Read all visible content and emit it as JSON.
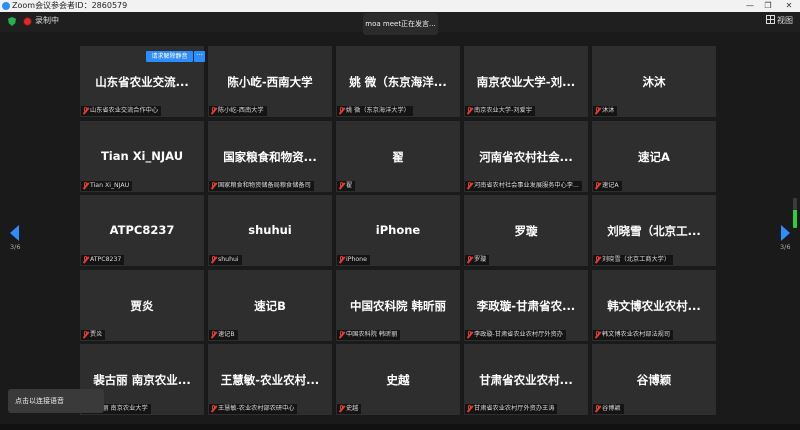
{
  "window": {
    "title": "Zoom会议参会者ID：2860579",
    "minimize": "—",
    "maximize": "❐",
    "close": "✕"
  },
  "topbar": {
    "recording": "录制中",
    "speaking": "moa meet正在发言...",
    "view": "视图"
  },
  "tile_actions": {
    "unmute": "请求解除静音",
    "more": "···"
  },
  "pagination": {
    "left": "3/6",
    "right": "3/6"
  },
  "toast": "点击以连接语音",
  "colors": {
    "accent": "#2d8cff",
    "tile_bg": "#2e2e2e",
    "muted_mic": "#e23b3b"
  },
  "participants": [
    {
      "name": "山东省农业交流...",
      "sub": "山东省农业交流合作中心"
    },
    {
      "name": "陈小屹-西南大学",
      "sub": "陈小屹-西南大学"
    },
    {
      "name": "姚 微（东京海洋...",
      "sub": "姚 微（东京海洋大学）"
    },
    {
      "name": "南京农业大学-刘...",
      "sub": "南京农业大学-刘爱宇"
    },
    {
      "name": "沐沐",
      "sub": "沐沐"
    },
    {
      "name": "Tian Xi_NJAU",
      "sub": "Tian Xi_NJAU"
    },
    {
      "name": "国家粮食和物资...",
      "sub": "国家粮食和物资储备局粮食储备司"
    },
    {
      "name": "翟",
      "sub": "翟"
    },
    {
      "name": "河南省农村社会...",
      "sub": "河南省农村社会事业发展服务中心李..."
    },
    {
      "name": "速记A",
      "sub": "速记A"
    },
    {
      "name": "ATPC8237",
      "sub": "ATPC8237"
    },
    {
      "name": "shuhui",
      "sub": "shuhui"
    },
    {
      "name": "iPhone",
      "sub": "iPhone"
    },
    {
      "name": "罗璇",
      "sub": "罗璇"
    },
    {
      "name": "刘晓雪（北京工...",
      "sub": "刘晓雪（北京工商大学）"
    },
    {
      "name": "贾炎",
      "sub": "贾炎"
    },
    {
      "name": "速记B",
      "sub": "速记B"
    },
    {
      "name": "中国农科院 韩昕丽",
      "sub": "中国农科院 韩昕丽"
    },
    {
      "name": "李政璇-甘肃省农...",
      "sub": "李政璇-甘肃省农业农村厅外资办"
    },
    {
      "name": "韩文博农业农村...",
      "sub": "韩文博农业农村部法规司"
    },
    {
      "name": "裴古丽 南京农业...",
      "sub": "裴古丽 南京农业大学"
    },
    {
      "name": "王慧敏-农业农村...",
      "sub": "王慧敏-农业农村部农研中心"
    },
    {
      "name": "史越",
      "sub": "史越"
    },
    {
      "name": "甘肃省农业农村...",
      "sub": "甘肃省农业农村厅外资办王涛"
    },
    {
      "name": "谷博颖",
      "sub": "谷博颖"
    }
  ]
}
